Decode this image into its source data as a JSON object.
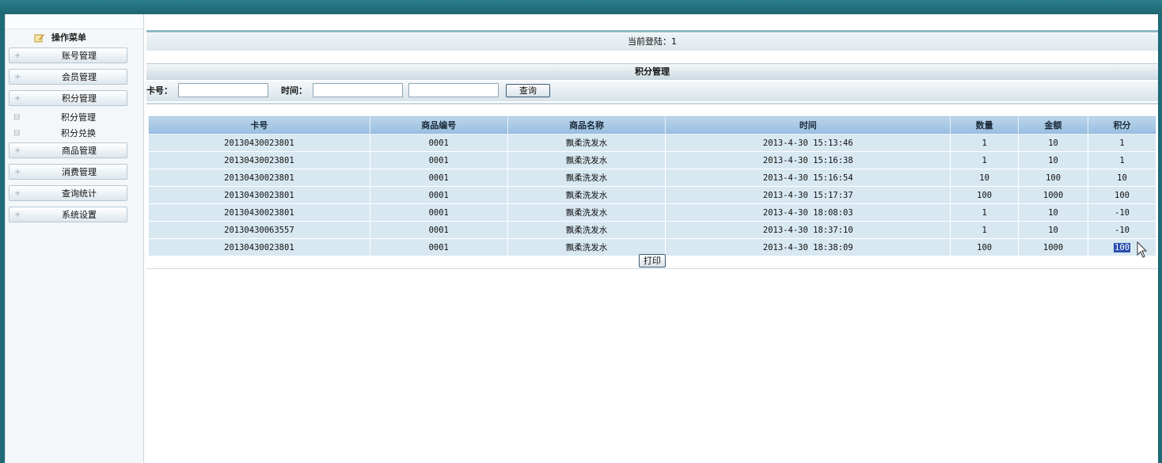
{
  "sidebar": {
    "title": "操作菜单",
    "items": [
      {
        "label": "账号管理"
      },
      {
        "label": "会员管理"
      },
      {
        "label": "积分管理"
      }
    ],
    "sub_items": [
      {
        "label": "积分管理"
      },
      {
        "label": "积分兑换"
      }
    ],
    "items_after": [
      {
        "label": "商品管理"
      },
      {
        "label": "消费管理"
      },
      {
        "label": "查询统计"
      },
      {
        "label": "系统设置"
      }
    ]
  },
  "header": {
    "login_text": "当前登陆：1"
  },
  "section": {
    "title": "积分管理"
  },
  "search": {
    "card_label": "卡号：",
    "card_value": "",
    "time_label": "时间：",
    "time_from": "",
    "time_to": "",
    "query_label": "查询"
  },
  "table": {
    "columns": [
      "卡号",
      "商品编号",
      "商品名称",
      "时间",
      "数量",
      "金额",
      "积分"
    ],
    "rows": [
      [
        "20130430023801",
        "0001",
        "飘柔洗发水",
        "2013-4-30 15:13:46",
        "1",
        "10",
        "1"
      ],
      [
        "20130430023801",
        "0001",
        "飘柔洗发水",
        "2013-4-30 15:16:38",
        "1",
        "10",
        "1"
      ],
      [
        "20130430023801",
        "0001",
        "飘柔洗发水",
        "2013-4-30 15:16:54",
        "10",
        "100",
        "10"
      ],
      [
        "20130430023801",
        "0001",
        "飘柔洗发水",
        "2013-4-30 15:17:37",
        "100",
        "1000",
        "100"
      ],
      [
        "20130430023801",
        "0001",
        "飘柔洗发水",
        "2013-4-30 18:08:03",
        "1",
        "10",
        "-10"
      ],
      [
        "20130430063557",
        "0001",
        "飘柔洗发水",
        "2013-4-30 18:37:10",
        "1",
        "10",
        "-10"
      ],
      [
        "20130430023801",
        "0001",
        "飘柔洗发水",
        "2013-4-30 18:38:09",
        "100",
        "1000",
        "100"
      ]
    ]
  },
  "print_label": "打印",
  "colors": {
    "background": "#1e6a77",
    "header_row": "#a9c9e6",
    "row": "#d7e8f1",
    "selection": "#2a4fb0"
  }
}
